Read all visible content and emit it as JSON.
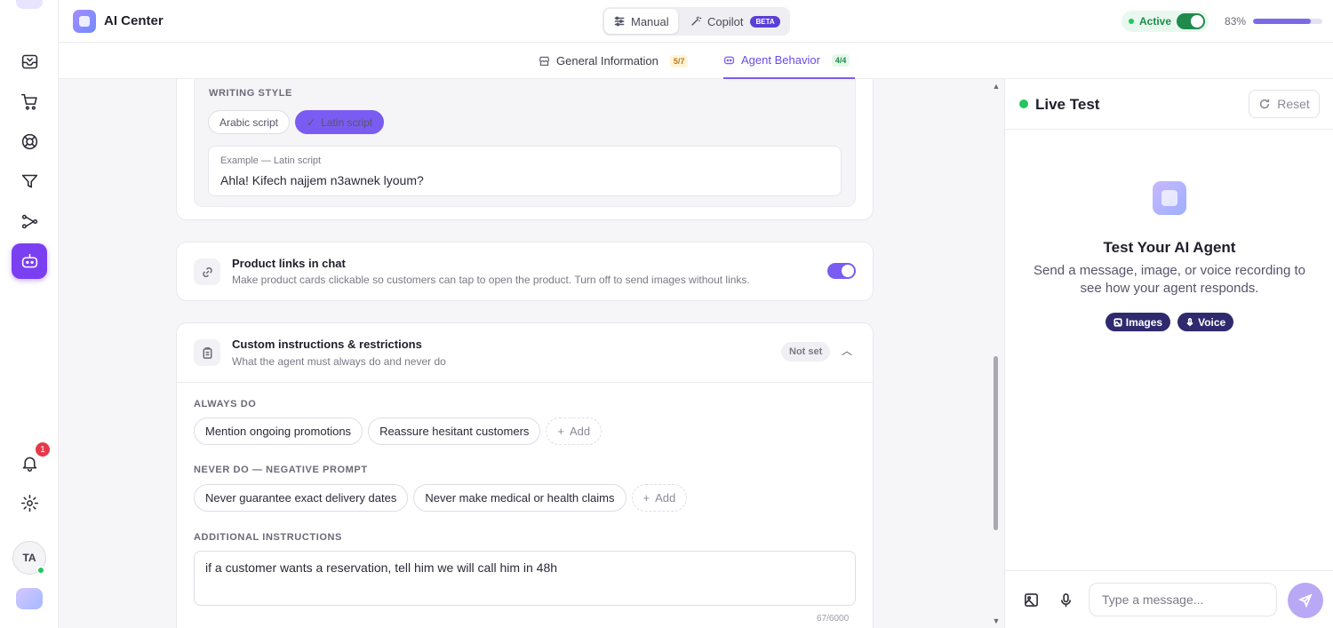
{
  "app": {
    "title": "AI Center"
  },
  "mode": {
    "manual": "Manual",
    "copilot": "Copilot",
    "beta": "BETA"
  },
  "status": {
    "active_label": "Active",
    "active": true,
    "percent_label": "83%",
    "progress": 0.83
  },
  "tabs": [
    {
      "label": "General Information",
      "count": "5/7"
    },
    {
      "label": "Agent Behavior",
      "count": "4/4"
    }
  ],
  "sidebar": {
    "notification_count": "1",
    "avatar_initials": "TA"
  },
  "writing_style": {
    "label": "WRITING STYLE",
    "options": [
      "Arabic script",
      "Latin script"
    ],
    "selected": "Latin script",
    "example_label": "Example — Latin script",
    "example_text": "Ahla! Kifech najjem n3awnek lyoum?"
  },
  "product_links": {
    "title": "Product links in chat",
    "description": "Make product cards clickable so customers can tap to open the product. Turn off to send images without links.",
    "enabled": true
  },
  "custom_instructions": {
    "title": "Custom instructions & restrictions",
    "subtitle": "What the agent must always do and never do",
    "badge": "Not set",
    "always_label": "ALWAYS DO",
    "always": [
      "Mention ongoing promotions",
      "Reassure hesitant customers"
    ],
    "never_label": "NEVER DO — NEGATIVE PROMPT",
    "never": [
      "Never guarantee exact delivery dates",
      "Never make medical or health claims"
    ],
    "add_label": "Add",
    "additional_label": "ADDITIONAL INSTRUCTIONS",
    "additional_text": "if a customer wants a reservation, tell him we will call him in 48h",
    "char_count": "67/6000"
  },
  "live_test": {
    "title": "Live Test",
    "reset": "Reset",
    "empty_title": "Test Your AI Agent",
    "empty_desc": "Send a message, image, or voice recording to see how your agent responds.",
    "capabilities": [
      "Images",
      "Voice"
    ],
    "input_placeholder": "Type a message..."
  },
  "colors": {
    "accent": "#7b5cf2",
    "active_green": "#1f8a4c",
    "capability_chip": "#2f2a6e"
  }
}
